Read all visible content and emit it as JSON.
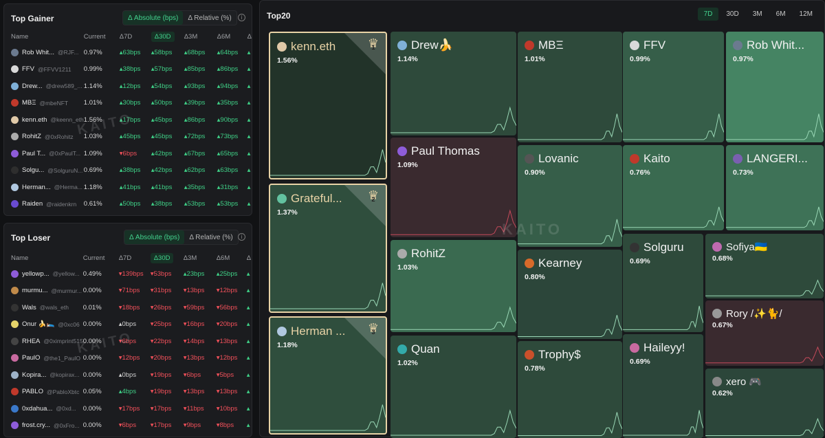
{
  "gainer": {
    "title": "Top Gainer",
    "toggle": [
      "Δ Absolute (bps)",
      "Δ Relative (%)"
    ],
    "columns": [
      "Name",
      "Current",
      "Δ7D",
      "Δ30D",
      "Δ3M",
      "Δ6M",
      "Δ"
    ],
    "rows": [
      {
        "name": "Rob Whit...",
        "handle": "@RJF...",
        "current": "0.97%",
        "d7": "63bps",
        "d30": "58bps",
        "m3": "68bps",
        "m6": "64bps",
        "dir": [
          "up",
          "up",
          "up",
          "up"
        ],
        "color": "#6b7a8f"
      },
      {
        "name": "FFV",
        "handle": "@FFVV1211",
        "current": "0.99%",
        "d7": "38bps",
        "d30": "57bps",
        "m3": "85bps",
        "m6": "86bps",
        "dir": [
          "up",
          "up",
          "up",
          "up"
        ],
        "color": "#d9d9d9"
      },
      {
        "name": "Drew...",
        "handle": "@drew589_...",
        "current": "1.14%",
        "d7": "12bps",
        "d30": "54bps",
        "m3": "93bps",
        "m6": "94bps",
        "dir": [
          "up",
          "up",
          "up",
          "up"
        ],
        "color": "#7fb0d8"
      },
      {
        "name": "MBΞ",
        "handle": "@mbeNFT",
        "current": "1.01%",
        "d7": "30bps",
        "d30": "50bps",
        "m3": "39bps",
        "m6": "35bps",
        "dir": [
          "up",
          "up",
          "up",
          "up"
        ],
        "color": "#c0392b"
      },
      {
        "name": "kenn.eth",
        "handle": "@keenn_eth",
        "current": "1.56%",
        "d7": "17bps",
        "d30": "45bps",
        "m3": "86bps",
        "m6": "90bps",
        "dir": [
          "up",
          "up",
          "up",
          "up"
        ],
        "color": "#e0c9a8"
      },
      {
        "name": "RohitZ",
        "handle": "@0xRohitz",
        "current": "1.03%",
        "d7": "45bps",
        "d30": "45bps",
        "m3": "72bps",
        "m6": "73bps",
        "dir": [
          "up",
          "up",
          "up",
          "up"
        ],
        "color": "#aaaaaa"
      },
      {
        "name": "Paul T...",
        "handle": "@0xPaulT...",
        "current": "1.09%",
        "d7": "6bps",
        "d30": "42bps",
        "m3": "67bps",
        "m6": "65bps",
        "dir": [
          "dn",
          "up",
          "up",
          "up"
        ],
        "color": "#8e5cd9"
      },
      {
        "name": "Solgu...",
        "handle": "@SolguruN...",
        "current": "0.69%",
        "d7": "38bps",
        "d30": "42bps",
        "m3": "62bps",
        "m6": "63bps",
        "dir": [
          "up",
          "up",
          "up",
          "up"
        ],
        "color": "#2e2e2e"
      },
      {
        "name": "Herman...",
        "handle": "@Herma...",
        "current": "1.18%",
        "d7": "41bps",
        "d30": "41bps",
        "m3": "35bps",
        "m6": "31bps",
        "dir": [
          "up",
          "up",
          "up",
          "up"
        ],
        "color": "#b0c8e0"
      },
      {
        "name": "Raiden",
        "handle": "@raidenkrn",
        "current": "0.61%",
        "d7": "50bps",
        "d30": "38bps",
        "m3": "53bps",
        "m6": "53bps",
        "dir": [
          "up",
          "up",
          "up",
          "up"
        ],
        "color": "#6a4bd1"
      }
    ]
  },
  "loser": {
    "title": "Top Loser",
    "toggle": [
      "Δ Absolute (bps)",
      "Δ Relative (%)"
    ],
    "columns": [
      "Name",
      "Current",
      "Δ7D",
      "Δ30D",
      "Δ3M",
      "Δ6M",
      "Δ"
    ],
    "rows": [
      {
        "name": "yellowp...",
        "handle": "@yellow...",
        "current": "0.49%",
        "d7": "139bps",
        "d30": "53bps",
        "m3": "23bps",
        "m6": "25bps",
        "dir": [
          "dn",
          "dn",
          "up",
          "up"
        ],
        "color": "#8e5cd9"
      },
      {
        "name": "murmu...",
        "handle": "@murmur...",
        "current": "0.00%",
        "d7": "71bps",
        "d30": "31bps",
        "m3": "13bps",
        "m6": "12bps",
        "dir": [
          "dn",
          "dn",
          "dn",
          "dn"
        ],
        "color": "#c08a4a"
      },
      {
        "name": "Wals",
        "handle": "@wals_eth",
        "current": "0.01%",
        "d7": "18bps",
        "d30": "26bps",
        "m3": "59bps",
        "m6": "56bps",
        "dir": [
          "dn",
          "dn",
          "dn",
          "dn"
        ],
        "color": "#333333"
      },
      {
        "name": "Onur 🍌🛌",
        "handle": "@0xc06",
        "current": "0.00%",
        "d7": "0bps",
        "d30": "25bps",
        "m3": "16bps",
        "m6": "20bps",
        "dir": [
          "neu",
          "dn",
          "dn",
          "dn"
        ],
        "color": "#e5d36a"
      },
      {
        "name": "RHEA",
        "handle": "@0ximprint515",
        "current": "0.00%",
        "d7": "6bps",
        "d30": "22bps",
        "m3": "14bps",
        "m6": "13bps",
        "dir": [
          "dn",
          "dn",
          "dn",
          "dn"
        ],
        "color": "#444444"
      },
      {
        "name": "PaulO",
        "handle": "@the1_PaulO",
        "current": "0.00%",
        "d7": "12bps",
        "d30": "20bps",
        "m3": "13bps",
        "m6": "12bps",
        "dir": [
          "dn",
          "dn",
          "dn",
          "dn"
        ],
        "color": "#c96aa0"
      },
      {
        "name": "Kopira...",
        "handle": "@kopirax...",
        "current": "0.00%",
        "d7": "0bps",
        "d30": "19bps",
        "m3": "6bps",
        "m6": "5bps",
        "dir": [
          "neu",
          "dn",
          "dn",
          "dn"
        ],
        "color": "#9fb3c8"
      },
      {
        "name": "PABLO",
        "handle": "@PabloXbtc",
        "current": "0.05%",
        "d7": "4bps",
        "d30": "19bps",
        "m3": "13bps",
        "m6": "13bps",
        "dir": [
          "up",
          "dn",
          "dn",
          "dn"
        ],
        "color": "#c0392b"
      },
      {
        "name": "0xdahua...",
        "handle": "@0xd...",
        "current": "0.00%",
        "d7": "17bps",
        "d30": "17bps",
        "m3": "11bps",
        "m6": "10bps",
        "dir": [
          "dn",
          "dn",
          "dn",
          "dn"
        ],
        "color": "#3a78c9"
      },
      {
        "name": "frost.cry...",
        "handle": "@0xFro...",
        "current": "0.00%",
        "d7": "6bps",
        "d30": "17bps",
        "m3": "9bps",
        "m6": "8bps",
        "dir": [
          "dn",
          "dn",
          "dn",
          "dn"
        ],
        "color": "#8e5cd9"
      }
    ]
  },
  "top20": {
    "title": "Top20",
    "tabs": [
      "7D",
      "30D",
      "3M",
      "6M",
      "12M"
    ],
    "watermark": "KAITO",
    "cells": [
      {
        "name": "kenn.eth",
        "pct": "1.56%",
        "rank": "1"
      },
      {
        "name": "Grateful...",
        "pct": "1.37%",
        "rank": "2"
      },
      {
        "name": "Herman ...",
        "pct": "1.18%",
        "rank": "3"
      },
      {
        "name": "Drew🍌",
        "pct": "1.14%"
      },
      {
        "name": "Paul Thomas",
        "pct": "1.09%"
      },
      {
        "name": "RohitZ",
        "pct": "1.03%"
      },
      {
        "name": "Quan",
        "pct": "1.02%"
      },
      {
        "name": "MBΞ",
        "pct": "1.01%"
      },
      {
        "name": "Lovanic",
        "pct": "0.90%"
      },
      {
        "name": "Kearney",
        "pct": "0.80%"
      },
      {
        "name": "Trophy$",
        "pct": "0.78%"
      },
      {
        "name": "FFV",
        "pct": "0.99%"
      },
      {
        "name": "Kaito",
        "pct": "0.76%"
      },
      {
        "name": "Solguru",
        "pct": "0.69%"
      },
      {
        "name": "Haileyy!",
        "pct": "0.69%"
      },
      {
        "name": "Rob Whit...",
        "pct": "0.97%"
      },
      {
        "name": "LANGERI...",
        "pct": "0.73%"
      },
      {
        "name": "Sofiya🇺🇦",
        "pct": "0.68%"
      },
      {
        "name": "Rory /✨🐈/",
        "pct": "0.67%"
      },
      {
        "name": "xero 🎮",
        "pct": "0.62%"
      }
    ]
  }
}
